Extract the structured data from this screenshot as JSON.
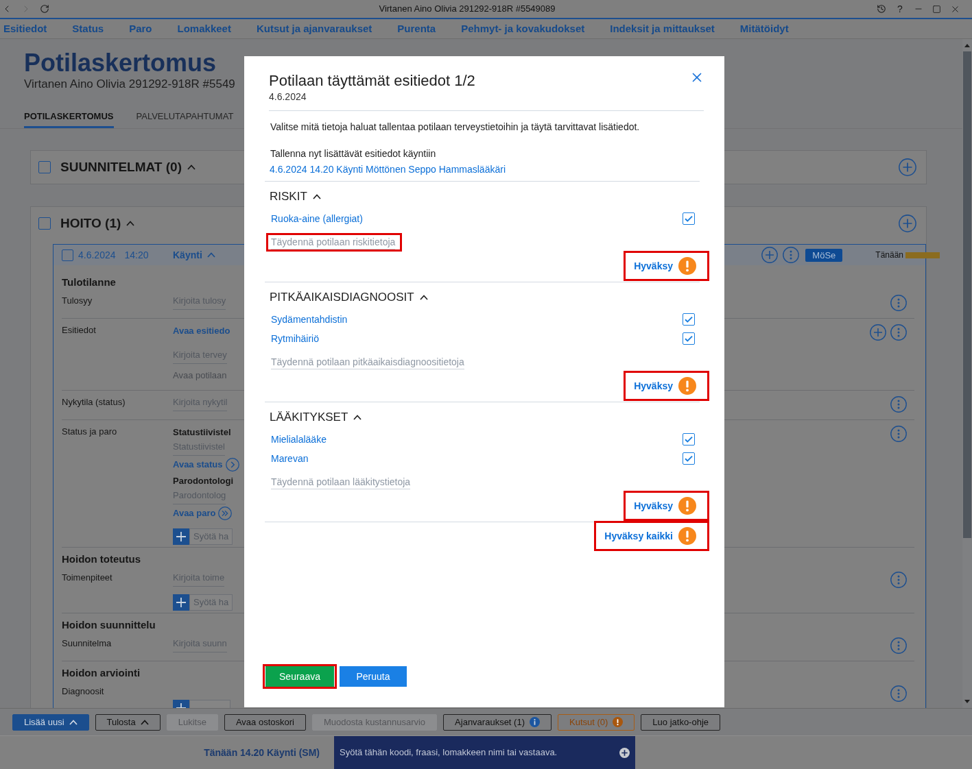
{
  "window": {
    "title": "Virtanen Aino Olivia 291292-918R #5549089",
    "help": "?"
  },
  "menu": [
    "Esitiedot",
    "Status",
    "Paro",
    "Lomakkeet",
    "Kutsut ja ajanvaraukset",
    "Purenta",
    "Pehmyt- ja kovakudokset",
    "Indeksit ja mittaukset",
    "Mitätöidyt"
  ],
  "page": {
    "title": "Potilaskertomus",
    "subtitle": "Virtanen Aino Olivia 291292-918R #5549",
    "tabs": [
      {
        "label": "POTILASKERTOMUS",
        "selected": true
      },
      {
        "label": "PALVELUTAPAHTUMAT",
        "selected": false
      }
    ]
  },
  "sections": [
    {
      "title": "SUUNNITELMAT (0)",
      "checked": false,
      "expanded": true
    },
    {
      "title": "HOITO (1)",
      "checked": false,
      "expanded": true,
      "visit": {
        "checked": false,
        "date": "4.6.2024",
        "time": "14:20",
        "type": "Käynti",
        "expanded": true,
        "badge": "MöSe",
        "when": "Tänään",
        "groups": [
          {
            "heading": "Tulotilanne",
            "rows": [
              {
                "label": "Tulosyy",
                "items": [
                  {
                    "kind": "field",
                    "placeholder": "Kirjoita tulosy"
                  }
                ],
                "actions": [
                  {
                    "kind": "more"
                  }
                ]
              },
              {
                "label": "Esitiedot",
                "items": [
                  {
                    "kind": "link",
                    "text": "Avaa esitiedo"
                  },
                  {
                    "kind": "field",
                    "placeholder": "Kirjoita tervey"
                  },
                  {
                    "kind": "hint",
                    "text": "Avaa potilaan"
                  }
                ],
                "actions": [
                  {
                    "kind": "add"
                  },
                  {
                    "kind": "more"
                  }
                ]
              },
              {
                "label": "Nykytila (status)",
                "items": [
                  {
                    "kind": "field",
                    "placeholder": "Kirjoita nykytil"
                  }
                ],
                "actions": [
                  {
                    "kind": "more"
                  }
                ]
              },
              {
                "label": "Status ja paro",
                "items": [
                  {
                    "kind": "title",
                    "text": "Statustiivistel"
                  },
                  {
                    "kind": "field",
                    "placeholder": "Statustiivistel"
                  },
                  {
                    "kind": "forward",
                    "text": "Avaa status"
                  },
                  {
                    "kind": "title",
                    "text": "Parodontologi"
                  },
                  {
                    "kind": "field",
                    "placeholder": "Parodontolog"
                  },
                  {
                    "kind": "skip",
                    "text": "Avaa paro"
                  },
                  {
                    "kind": "entry",
                    "placeholder": "Syötä ha"
                  }
                ],
                "actions": [
                  {
                    "kind": "more"
                  }
                ]
              }
            ]
          },
          {
            "heading": "Hoidon toteutus",
            "rows": [
              {
                "label": "Toimenpiteet",
                "items": [
                  {
                    "kind": "field",
                    "placeholder": "Kirjoita toime"
                  },
                  {
                    "kind": "entry",
                    "placeholder": "Syötä ha"
                  }
                ],
                "actions": [
                  {
                    "kind": "more"
                  }
                ]
              }
            ]
          },
          {
            "heading": "Hoidon suunnittelu",
            "rows": [
              {
                "label": "Suunnitelma",
                "items": [
                  {
                    "kind": "field",
                    "placeholder": "Kirjoita suunn"
                  }
                ],
                "actions": [
                  {
                    "kind": "more"
                  }
                ]
              }
            ]
          },
          {
            "heading": "Hoidon arviointi",
            "rows": [
              {
                "label": "Diagnoosit",
                "items": [
                  {
                    "kind": "entry"
                  }
                ],
                "actions": [
                  {
                    "kind": "more"
                  }
                ]
              }
            ]
          }
        ]
      }
    }
  ],
  "toolbar": [
    {
      "label": "Lisää uusi",
      "kind": "primary",
      "menu": true,
      "disabled": false
    },
    {
      "label": "Tulosta",
      "kind": "outline",
      "menu": true,
      "disabled": false
    },
    {
      "label": "Lukitse",
      "menu": false,
      "disabled": true
    },
    {
      "label": "Avaa ostoskori",
      "kind": "outline",
      "menu": false,
      "disabled": false
    },
    {
      "label": "Muodosta kustannusarvio",
      "menu": false,
      "disabled": true
    },
    {
      "label": "Ajanvaraukset (1)",
      "kind": "info",
      "menu": false,
      "disabled": false
    },
    {
      "label": "Kutsut (0)",
      "kind": "warning",
      "menu": false,
      "disabled": false
    },
    {
      "label": "Luo jatko-ohje",
      "kind": "outline",
      "menu": false,
      "disabled": false
    }
  ],
  "status_bar": {
    "context": "Tänään 14.20 Käynti (SM)",
    "command_placeholder": "Syötä tähän koodi, fraasi, lomakkeen nimi tai vastaava."
  },
  "dialog": {
    "title": "Potilaan täyttämät esitiedot 1/2",
    "date": "4.6.2024",
    "intro": "Valitse mitä tietoja haluat tallentaa potilaan terveystietoihin ja täytä tarvittavat lisätiedot.",
    "save_label": "Tallenna nyt lisättävät esitiedot käyntiin",
    "visit_link": "4.6.2024 14.20 Käynti Möttönen Seppo Hammaslääkäri",
    "groups": [
      {
        "title": "RISKIT",
        "expanded": true,
        "items": [
          {
            "label": "Ruoka-aine (allergiat)",
            "checked": true
          }
        ],
        "field": {
          "placeholder": "Täydennä potilaan riskitietoja",
          "highlighted": true
        },
        "approve": {
          "label": "Hyväksy",
          "highlighted": true
        }
      },
      {
        "title": "PITKÄAIKAISDIAGNOOSIT",
        "expanded": true,
        "items": [
          {
            "label": "Sydämentahdistin",
            "checked": true
          },
          {
            "label": "Rytmihäiriö",
            "checked": true
          }
        ],
        "field": {
          "placeholder": "Täydennä potilaan pitkäaikaisdiagnoositietoja",
          "highlighted": false
        },
        "approve": {
          "label": "Hyväksy",
          "highlighted": true
        }
      },
      {
        "title": "LÄÄKITYKSET",
        "expanded": true,
        "items": [
          {
            "label": "Mielialalääke",
            "checked": true
          },
          {
            "label": "Marevan",
            "checked": true
          }
        ],
        "field": {
          "placeholder": "Täydennä potilaan lääkitystietoja",
          "highlighted": false
        },
        "approve": {
          "label": "Hyväksy",
          "highlighted": true
        }
      }
    ],
    "approve_all": {
      "label": "Hyväksy kaikki",
      "highlighted": true
    },
    "buttons": [
      {
        "label": "Seuraava",
        "kind": "primary",
        "highlighted": true
      },
      {
        "label": "Peruuta",
        "kind": "secondary",
        "highlighted": false
      }
    ]
  }
}
